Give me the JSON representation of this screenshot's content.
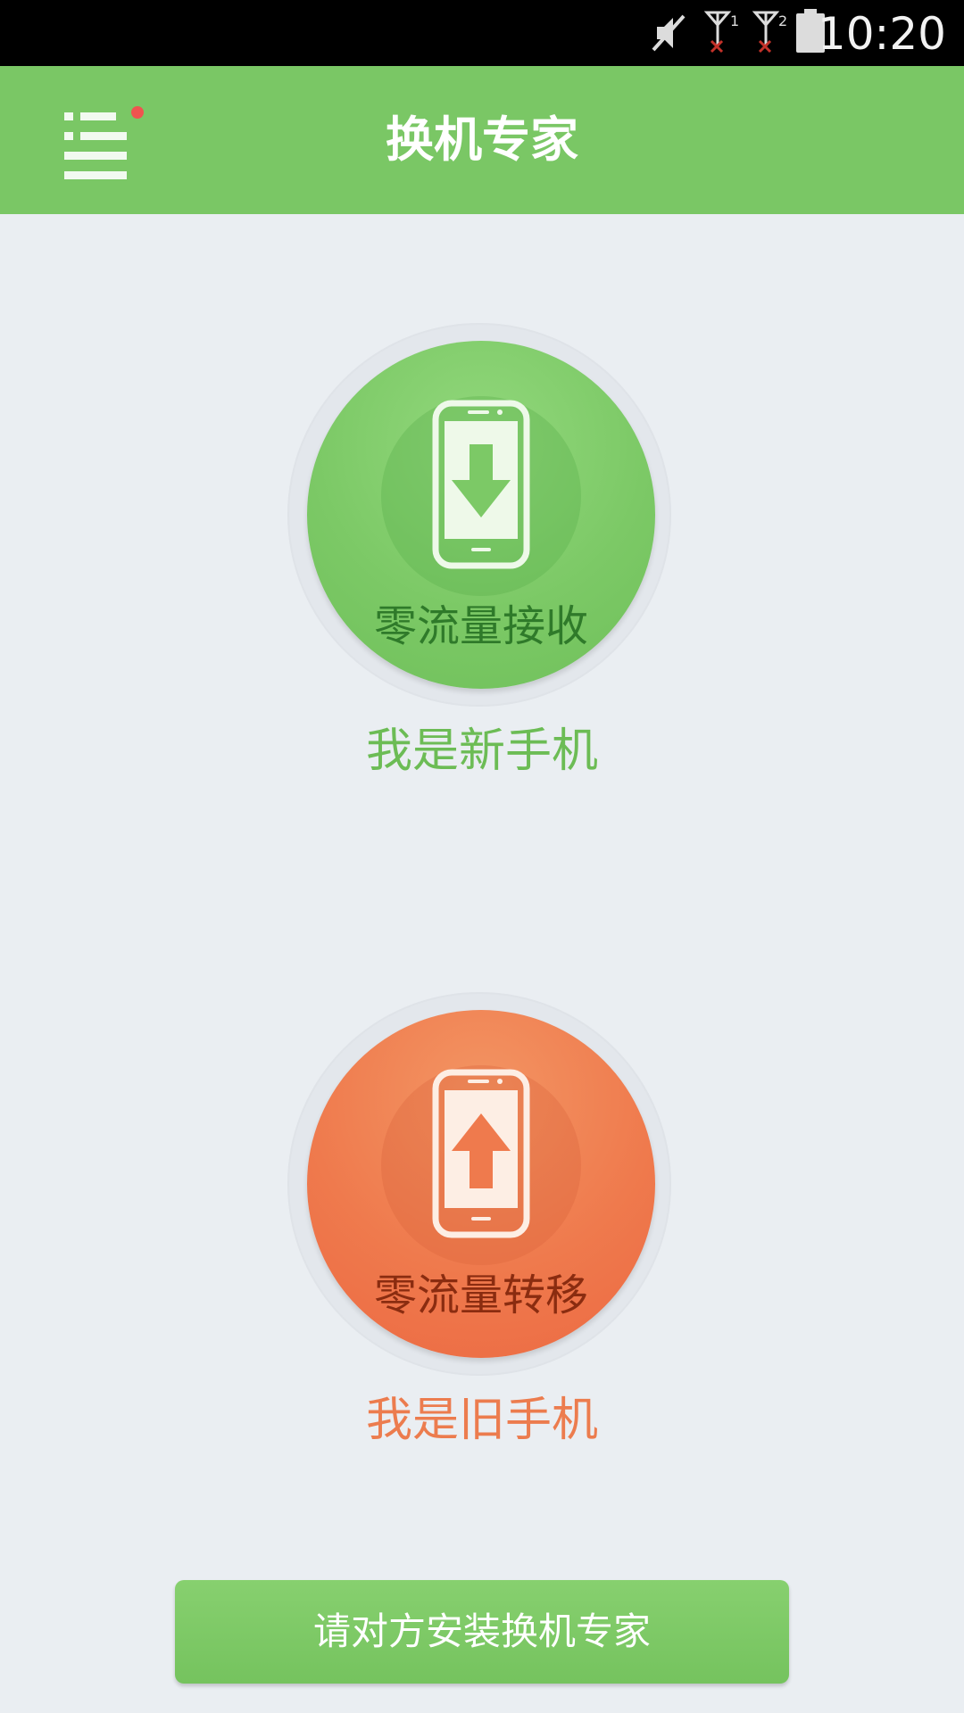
{
  "status_bar": {
    "time": "10:20",
    "icons": [
      "mute-icon",
      "signal-sim1-no-service-icon",
      "signal-sim2-no-service-icon",
      "battery-icon"
    ],
    "sim1_label": "1",
    "sim2_label": "2"
  },
  "app_bar": {
    "title": "换机专家",
    "menu_icon": "menu-icon",
    "notification_dot_color": "#f0544f"
  },
  "receive": {
    "action_label": "零流量接收",
    "role_label": "我是新手机",
    "icon": "phone-download-icon",
    "color": "#7ac765"
  },
  "send": {
    "action_label": "零流量转移",
    "role_label": "我是旧手机",
    "icon": "phone-upload-icon",
    "color": "#ef7a4d"
  },
  "footer": {
    "install_button_label": "请对方安装换机专家"
  },
  "colors": {
    "primary_green": "#7ac765",
    "accent_orange": "#ef7a4d",
    "background": "#eaeef2"
  }
}
